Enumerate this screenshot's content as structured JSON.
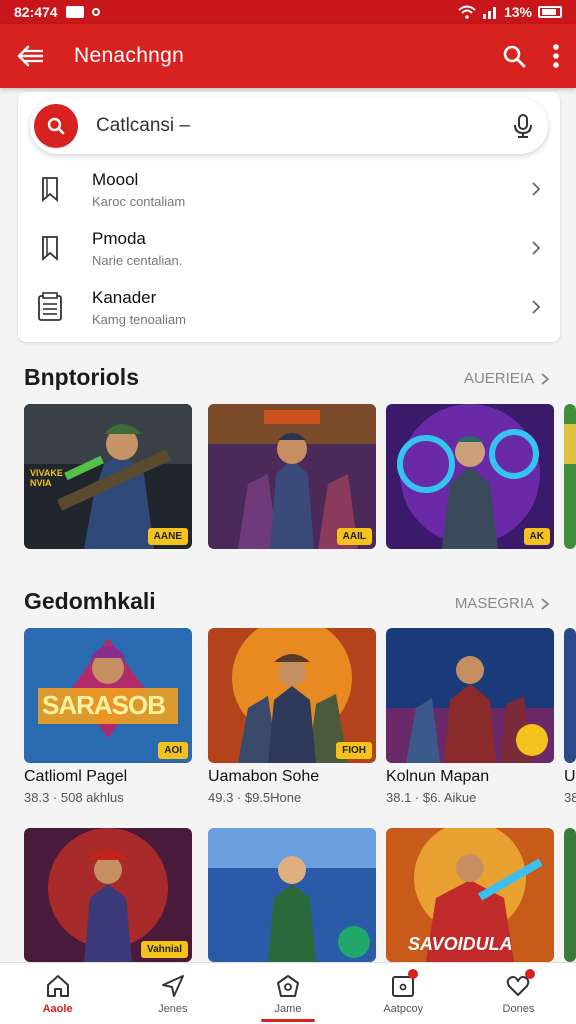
{
  "status_bar": {
    "time": "82:474",
    "battery": "13%"
  },
  "app_bar": {
    "title": "Nenachngn",
    "back_icon": "arrow-left-icon",
    "search_icon": "search-icon",
    "menu_icon": "more-vert-icon"
  },
  "search": {
    "text": "Catlcansi –",
    "mic_icon": "mic-icon"
  },
  "menu_list": [
    {
      "title": "Moool",
      "subtitle": "Karoc contaliam",
      "icon": "bookmark-icon"
    },
    {
      "title": "Pmoda",
      "subtitle": "Narie centalian.",
      "icon": "bookmark-icon"
    },
    {
      "title": "Kanader",
      "subtitle": "Kamg tenoaliam",
      "icon": "document-icon"
    }
  ],
  "section1": {
    "title": "Bnptoriols",
    "link": "AUERIEIA"
  },
  "section1_games": [
    {
      "badge": "AANE",
      "art_text": "VIVAKE NVIA"
    },
    {
      "badge": "AAIL"
    },
    {
      "badge": "AK"
    }
  ],
  "section2": {
    "title": "Gedomhkali",
    "link": "MASEGRIA"
  },
  "section2_games": [
    {
      "title": "Catlioml Pagel",
      "meta": "38.3 · 508 akhlus",
      "badge": "AOI",
      "art_text": "SARASOB"
    },
    {
      "title": "Uamabon Sohe",
      "meta": "49.3 · $9.5Hone",
      "badge": "FIOH"
    },
    {
      "title": "Kolnun Mapan",
      "meta": "38.1 · $6. Aikue",
      "badge": ""
    },
    {
      "title": "U",
      "meta": "38"
    }
  ],
  "section3_games": [
    {
      "badge": "Vahnial"
    },
    {
      "badge": ""
    },
    {
      "badge": "",
      "art_text": "SAVOIDULA"
    }
  ],
  "bottom_nav": [
    {
      "label": "Aaole",
      "icon": "home-icon",
      "active": true
    },
    {
      "label": "Jenes",
      "icon": "send-icon",
      "active": false
    },
    {
      "label": "Jame",
      "icon": "pentagon-icon",
      "active": false
    },
    {
      "label": "Aatpcoy",
      "icon": "square-dot-icon",
      "active": false
    },
    {
      "label": "Dones",
      "icon": "heart-icon",
      "active": false
    }
  ],
  "colors": {
    "primary": "#d8221f",
    "status": "#c8161b",
    "badge": "#f3c21c"
  }
}
